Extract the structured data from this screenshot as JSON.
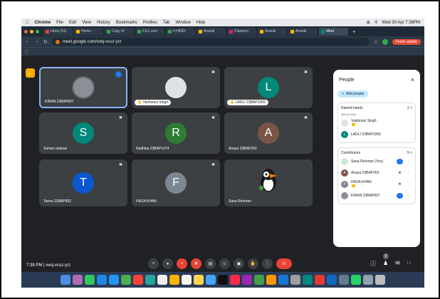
{
  "menubar": {
    "app": "Chrome",
    "items": [
      "File",
      "Edit",
      "View",
      "History",
      "Bookmarks",
      "Profiles",
      "Tab",
      "Window",
      "Help"
    ],
    "datetime": "Wed 30 Apr 7:38PM"
  },
  "tabs": [
    "Inbox (51)",
    "Home -",
    "Copy of",
    "II E1 sem",
    "II HINDI",
    "Aravali",
    "Classroo",
    "Aravali",
    "Aravali",
    "Meet"
  ],
  "address": {
    "url": "meet.google.com/vwq-vcuz-yrz",
    "finish_label": "Finish update"
  },
  "tiles": {
    "t1": {
      "name": "KIRAN 23BAP837"
    },
    "t2": {
      "name": "Vaishnavi Singh"
    },
    "t3": {
      "name": "LADLI 23BAP1065",
      "initial": "L"
    },
    "t4": {
      "name": "Suhani raniwal",
      "initial": "S"
    },
    "t5": {
      "name": "Radhika 23BAP1474",
      "initial": "R"
    },
    "t6": {
      "name": "Anaya 23BAP260",
      "initial": "A"
    },
    "t7": {
      "name": "Tannu 23BAP692",
      "initial": "T"
    },
    "t8": {
      "name": "FAIZA KHAN",
      "initial": "F"
    },
    "t9": {
      "name": "Sana Rehman"
    }
  },
  "controls": {
    "meeting_info": "7:38 PM  |  vwq-vcuz-yrz",
    "participant_count": "9"
  },
  "panel": {
    "title": "People",
    "add_people": "Add people",
    "raised_hands": {
      "label": "Raised hands",
      "count": "2",
      "order": "(first to last)"
    },
    "raised": [
      {
        "name": "Vaishnavi Singh",
        "initial": ""
      },
      {
        "name": "LADLI 23BAP1065",
        "initial": "L"
      }
    ],
    "contributors": {
      "label": "Contributors",
      "count": "9"
    },
    "people": [
      {
        "name": "Sana Rehman (You)",
        "initial": ""
      },
      {
        "name": "Anaya 23BAP260",
        "initial": "A"
      },
      {
        "name": "FAIZA KHAN",
        "initial": "F"
      },
      {
        "name": "KIRAN 23BAP837",
        "initial": ""
      }
    ]
  },
  "colors": {
    "meet_bg": "#202124",
    "tile_bg": "#3c4043",
    "accent_blue": "#8ab4f8",
    "red": "#ea4335"
  }
}
